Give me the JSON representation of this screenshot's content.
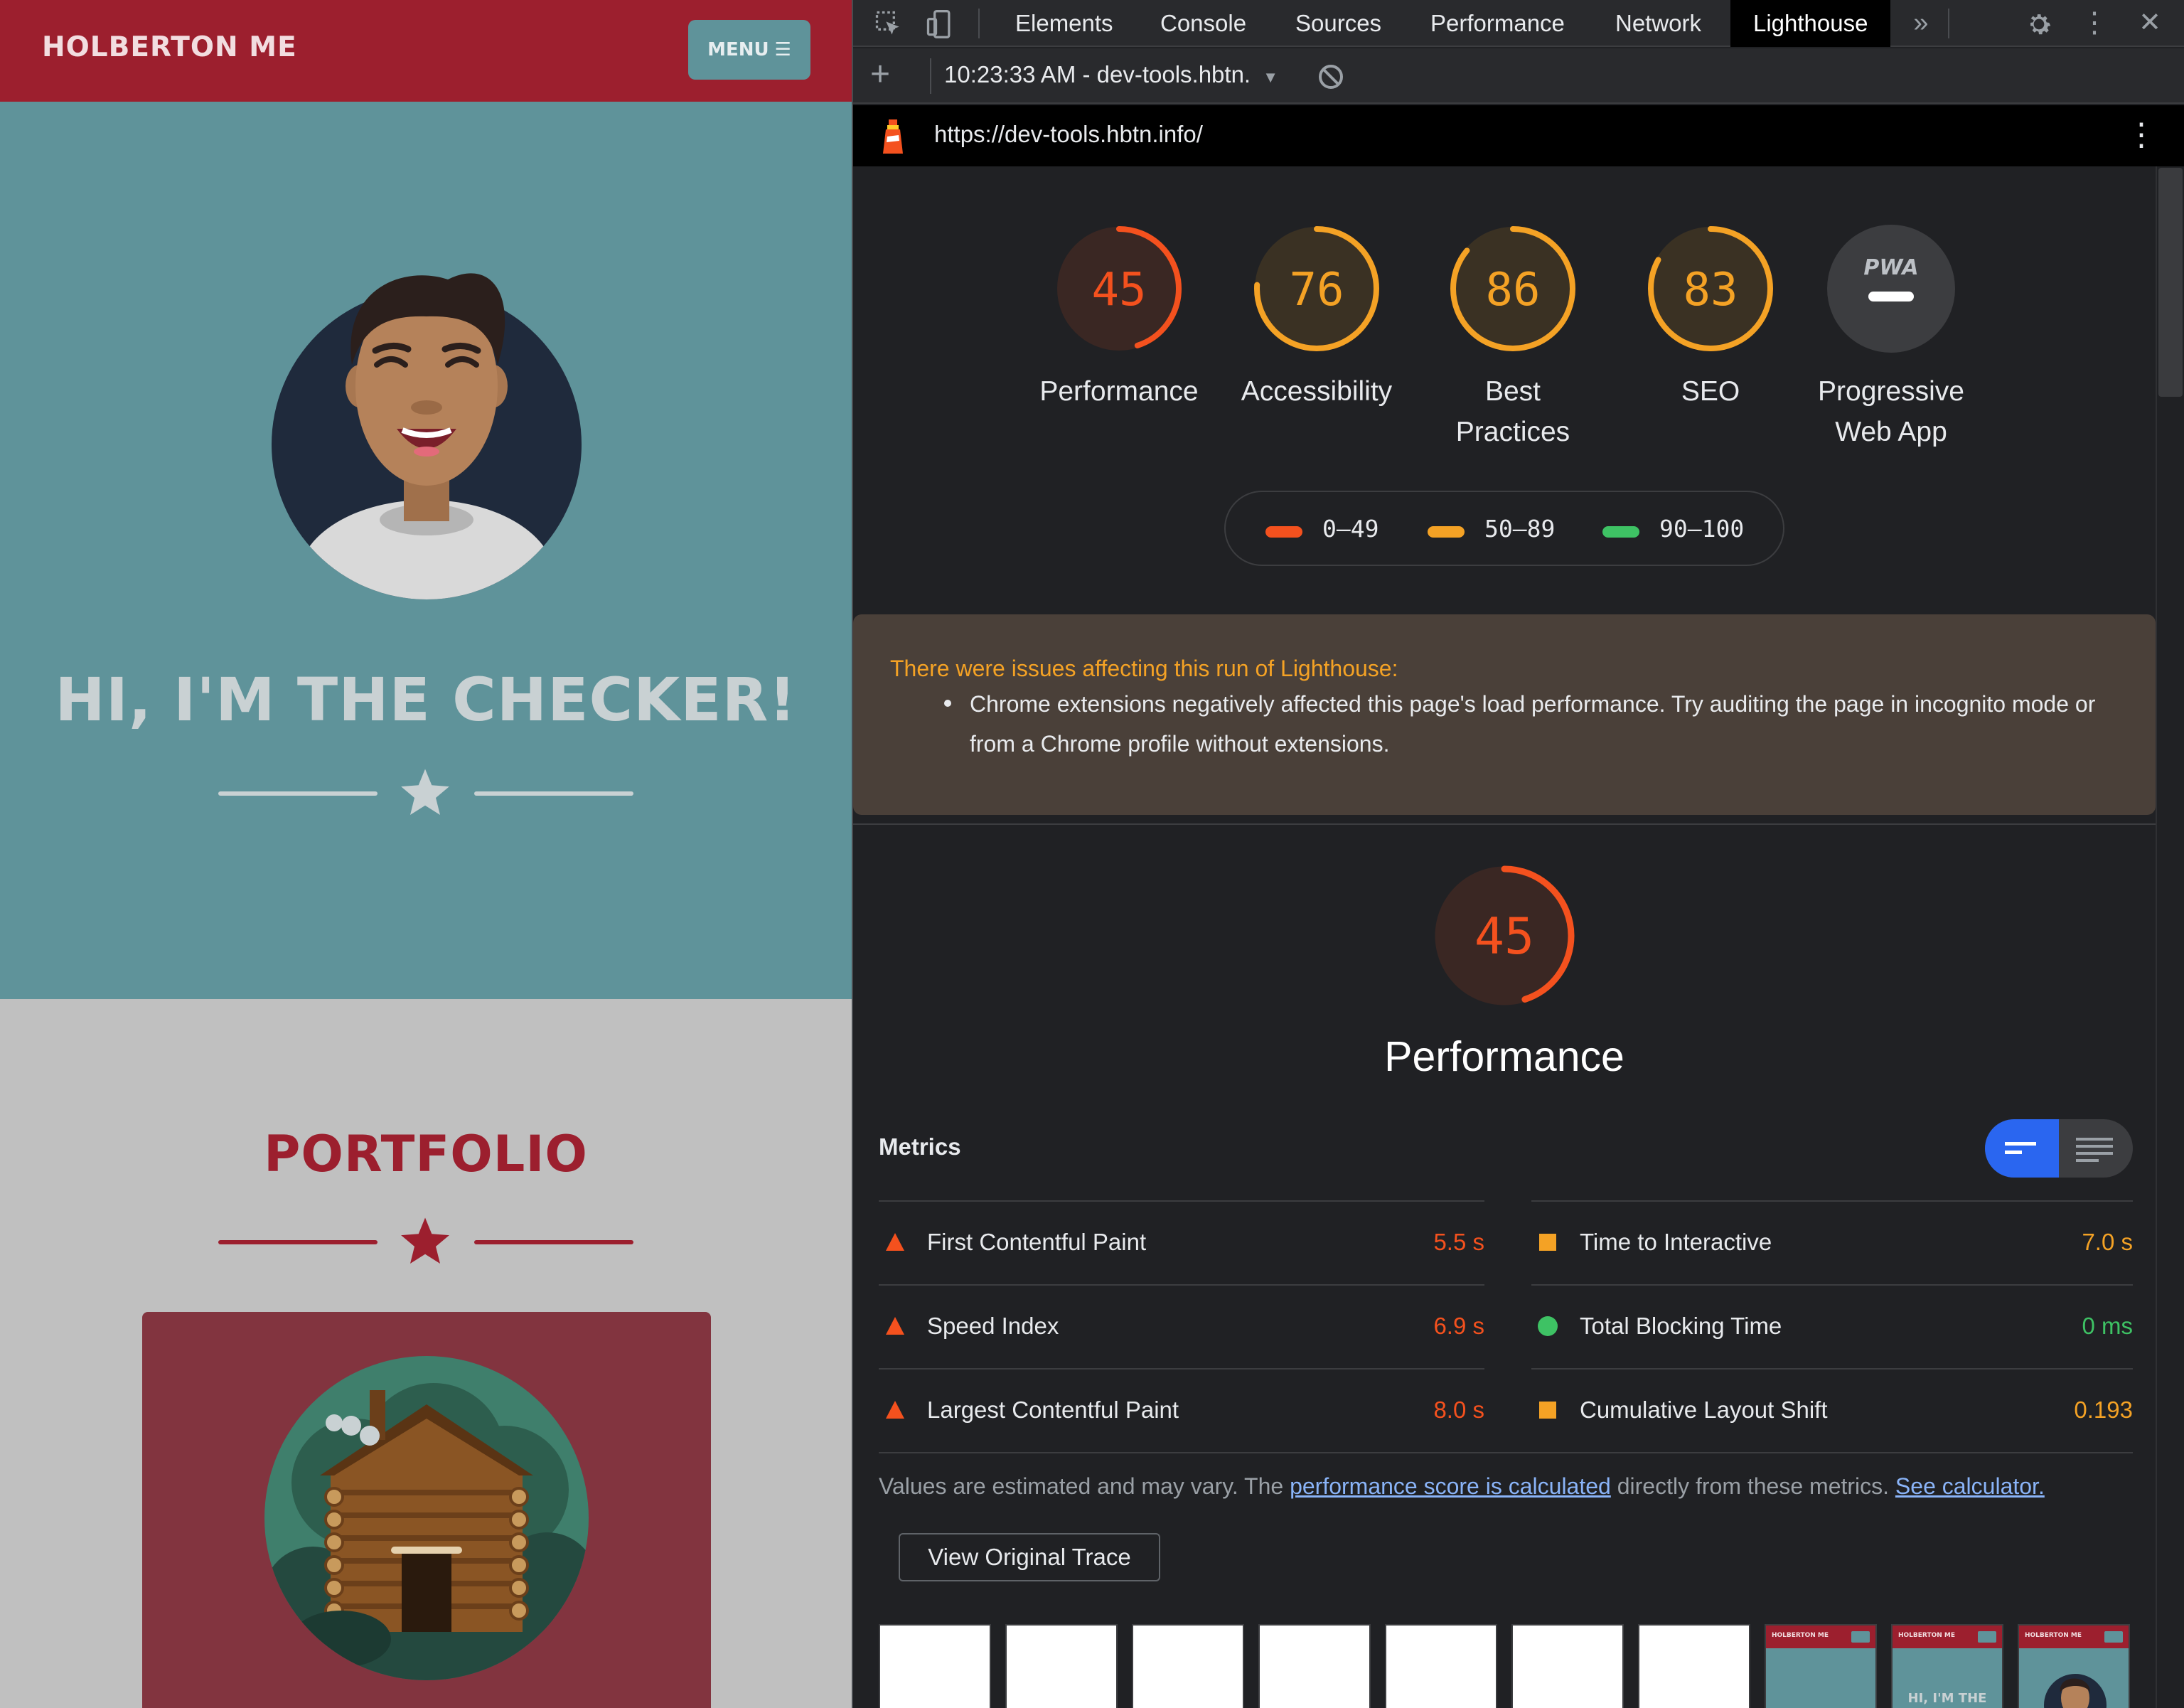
{
  "site": {
    "brand": "HOLBERTON ME",
    "menu_label": "MENU",
    "hero_title": "HI, I'M THE CHECKER!",
    "portfolio_title": "PORTFOLIO"
  },
  "devtools": {
    "tabs": [
      "Elements",
      "Console",
      "Sources",
      "Performance",
      "Network",
      "Lighthouse"
    ],
    "active_tab": "Lighthouse",
    "report_select": "10:23:33 AM - dev-tools.hbtn.",
    "url": "https://dev-tools.hbtn.info/"
  },
  "scores": [
    {
      "value": "45",
      "label_line1": "Performance",
      "label_line2": "",
      "level": 45,
      "color": "#f4511e"
    },
    {
      "value": "76",
      "label_line1": "Accessibility",
      "label_line2": "",
      "level": 76,
      "color": "#f4a225"
    },
    {
      "value": "86",
      "label_line1": "Best",
      "label_line2": "Practices",
      "level": 86,
      "color": "#f4a225"
    },
    {
      "value": "83",
      "label_line1": "SEO",
      "label_line2": "",
      "level": 83,
      "color": "#f4a225"
    }
  ],
  "pwa": {
    "badge": "PWA",
    "label_line1": "Progressive",
    "label_line2": "Web App"
  },
  "legend": [
    {
      "range": "0–49",
      "color": "#f4511e"
    },
    {
      "range": "50–89",
      "color": "#f4a225"
    },
    {
      "range": "90–100",
      "color": "#3ec264"
    }
  ],
  "warning": {
    "title": "There were issues affecting this run of Lighthouse:",
    "item": "Chrome extensions negatively affected this page's load performance. Try auditing the page in incognito mode or from a Chrome profile without extensions."
  },
  "performance": {
    "score": "45",
    "level": 45,
    "title": "Performance",
    "metrics_title": "Metrics",
    "metrics_left": [
      {
        "name": "First Contentful Paint",
        "value": "5.5 s",
        "status": "fail",
        "color": "#f4511e"
      },
      {
        "name": "Speed Index",
        "value": "6.9 s",
        "status": "fail",
        "color": "#f4511e"
      },
      {
        "name": "Largest Contentful Paint",
        "value": "8.0 s",
        "status": "fail",
        "color": "#f4511e"
      }
    ],
    "metrics_right": [
      {
        "name": "Time to Interactive",
        "value": "7.0 s",
        "status": "average",
        "color": "#f4a225"
      },
      {
        "name": "Total Blocking Time",
        "value": "0 ms",
        "status": "pass",
        "color": "#3ec264"
      },
      {
        "name": "Cumulative Layout Shift",
        "value": "0.193",
        "status": "average",
        "color": "#f4a225"
      }
    ],
    "note_prefix": "Values are estimated and may vary. The ",
    "note_link1": "performance score is calculated",
    "note_middle": " directly from these metrics. ",
    "note_link2": "See calculator.",
    "trace_button": "View Original Trace",
    "filmstrip_hero_text": "HI, I'M THE",
    "filmstrip_brand": "HOLBERTON ME"
  }
}
